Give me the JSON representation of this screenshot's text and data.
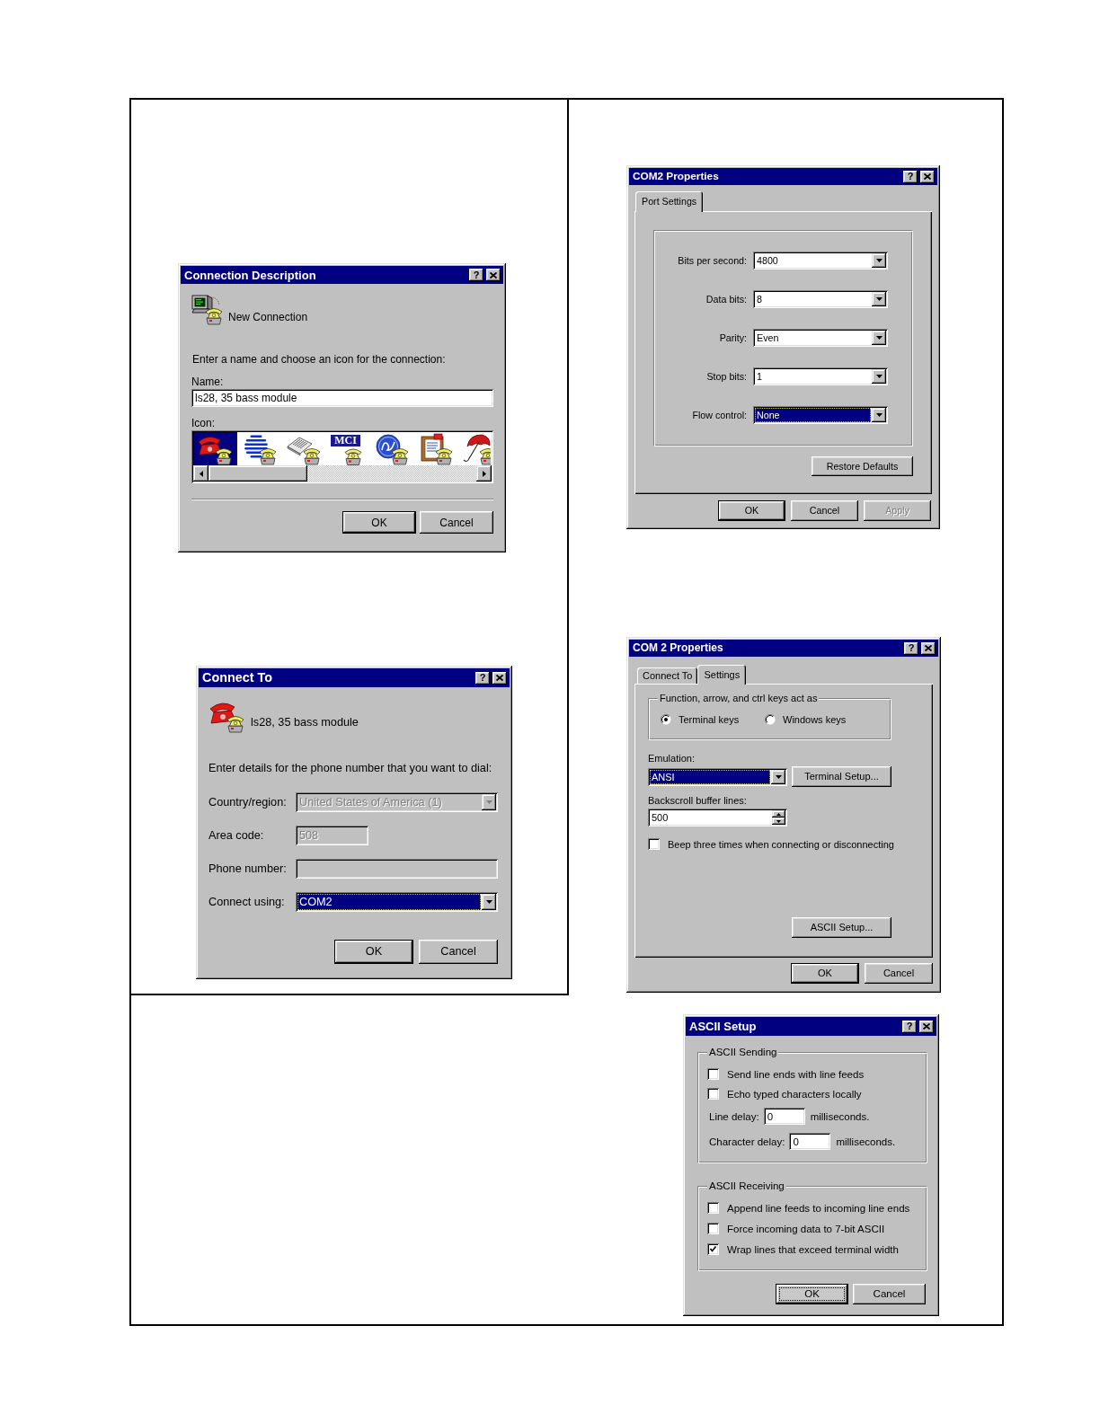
{
  "connection_description": {
    "title": "Connection Description",
    "help_button": "?",
    "connection_name": "New Connection",
    "prompt": "Enter a name and choose an icon for the connection:",
    "name_label": "Name:",
    "name_value": "ls28, 35 bass module",
    "icon_label": "Icon:",
    "icons": [
      {
        "kind": "telephone",
        "selected": true
      },
      {
        "kind": "striped_globe",
        "selected": false
      },
      {
        "kind": "newspaper",
        "selected": false
      },
      {
        "kind": "logo",
        "text": "MCI",
        "selected": false
      },
      {
        "kind": "emblem",
        "selected": false
      },
      {
        "kind": "documents",
        "selected": false
      },
      {
        "kind": "umbrella",
        "selected": false
      }
    ],
    "buttons": [
      {
        "label": "OK",
        "default": true
      },
      {
        "label": "Cancel",
        "default": false
      }
    ]
  },
  "connect_to": {
    "title": "Connect To",
    "help_button": "?",
    "connection_name": "ls28, 35 bass module",
    "prompt": "Enter details for the phone number that you want to dial:",
    "fields": [
      {
        "kind": "dropdown",
        "label": "Country/region:",
        "value": "United States of America (1)",
        "disabled": true,
        "focused": false
      },
      {
        "kind": "text",
        "label": "Area code:",
        "value": "508",
        "disabled": true
      },
      {
        "kind": "text",
        "label": "Phone number:",
        "disabled": true
      },
      {
        "kind": "dropdown",
        "label": "Connect using:",
        "value": "COM2",
        "disabled": false,
        "focused": true
      }
    ],
    "buttons": [
      {
        "label": "OK",
        "default": true
      },
      {
        "label": "Cancel",
        "default": false
      }
    ]
  },
  "port_settings_dialog": {
    "title": "COM2 Properties",
    "help_button": "?",
    "tabs": [
      {
        "label": "Port Settings",
        "selected": true
      }
    ],
    "settings": [
      {
        "label": "Bits per second:",
        "value": "4800",
        "focused": false
      },
      {
        "label": "Data bits:",
        "value": "8",
        "focused": false
      },
      {
        "label": "Parity:",
        "value": "Even",
        "focused": false
      },
      {
        "label": "Stop bits:",
        "value": "1",
        "focused": false
      },
      {
        "label": "Flow control:",
        "value": "None",
        "focused": true
      }
    ],
    "restore_button": "Restore Defaults",
    "buttons": [
      {
        "label": "OK",
        "default": true,
        "disabled": false
      },
      {
        "label": "Cancel",
        "default": false,
        "disabled": false
      },
      {
        "label": "Apply",
        "default": false,
        "disabled": true
      }
    ]
  },
  "settings_dialog": {
    "title": "COM 2 Properties",
    "help_button": "?",
    "tabs": [
      {
        "label": "Connect To",
        "selected": false
      },
      {
        "label": "Settings",
        "selected": true
      }
    ],
    "keys_group": {
      "label": "Function, arrow, and ctrl keys act as",
      "options": [
        {
          "label": "Terminal keys",
          "selected": true
        },
        {
          "label": "Windows keys",
          "selected": false
        }
      ]
    },
    "emulation_label": "Emulation:",
    "emulation": {
      "value": "ANSI",
      "focused": true
    },
    "terminal_setup_button": "Terminal Setup...",
    "backscroll_label": "Backscroll buffer lines:",
    "backscroll_value": "500",
    "beep": {
      "label": "Beep three times when connecting or disconnecting",
      "checked": false
    },
    "ascii_setup_button": "ASCII Setup...",
    "buttons": [
      {
        "label": "OK",
        "default": true
      },
      {
        "label": "Cancel",
        "default": false
      }
    ]
  },
  "ascii_setup": {
    "title": "ASCII Setup",
    "help_button": "?",
    "groups": [
      {
        "label": "ASCII Sending",
        "items": [
          {
            "kind": "checkbox",
            "label": "Send line ends with line feeds",
            "checked": false
          },
          {
            "kind": "checkbox",
            "label": "Echo typed characters locally",
            "checked": false
          },
          {
            "kind": "delay",
            "label": "Line delay:",
            "value": "0",
            "unit": "milliseconds."
          },
          {
            "kind": "delay",
            "label": "Character delay:",
            "value": "0",
            "unit": "milliseconds."
          }
        ]
      },
      {
        "label": "ASCII Receiving",
        "items": [
          {
            "kind": "checkbox",
            "label": "Append line feeds to incoming line ends",
            "checked": false
          },
          {
            "kind": "checkbox",
            "label": "Force incoming data to 7-bit ASCII",
            "checked": false
          },
          {
            "kind": "checkbox",
            "label": "Wrap lines that exceed terminal width",
            "checked": true
          }
        ]
      }
    ],
    "buttons": [
      {
        "label": "OK",
        "default": true,
        "focused": true
      },
      {
        "label": "Cancel",
        "default": false,
        "focused": false
      }
    ]
  }
}
